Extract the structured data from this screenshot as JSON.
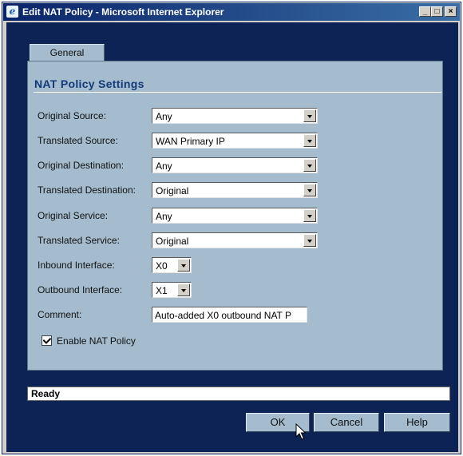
{
  "window": {
    "title": "Edit NAT Policy - Microsoft Internet Explorer"
  },
  "titlebar_buttons": {
    "minimize": "_",
    "maximize": "□",
    "close": "×"
  },
  "tabs": [
    {
      "label": "General"
    }
  ],
  "section": {
    "title": "NAT Policy Settings"
  },
  "fields": {
    "original_source": {
      "label": "Original Source:",
      "value": "Any"
    },
    "translated_source": {
      "label": "Translated Source:",
      "value": "WAN Primary IP"
    },
    "original_destination": {
      "label": "Original Destination:",
      "value": "Any"
    },
    "translated_destination": {
      "label": "Translated Destination:",
      "value": "Original"
    },
    "original_service": {
      "label": "Original Service:",
      "value": "Any"
    },
    "translated_service": {
      "label": "Translated Service:",
      "value": "Original"
    },
    "inbound_interface": {
      "label": "Inbound Interface:",
      "value": "X0"
    },
    "outbound_interface": {
      "label": "Outbound Interface:",
      "value": "X1"
    },
    "comment": {
      "label": "Comment:",
      "value": "Auto-added X0 outbound NAT P"
    }
  },
  "enable_nat": {
    "label": "Enable NAT Policy",
    "checked": true
  },
  "status": {
    "text": "Ready"
  },
  "buttons": {
    "ok": "OK",
    "cancel": "Cancel",
    "help": "Help"
  },
  "colors": {
    "title_bar": "#0a246a",
    "client_bg": "#0d2255",
    "panel_bg": "#a4bccd",
    "section_title": "#123a7a"
  }
}
